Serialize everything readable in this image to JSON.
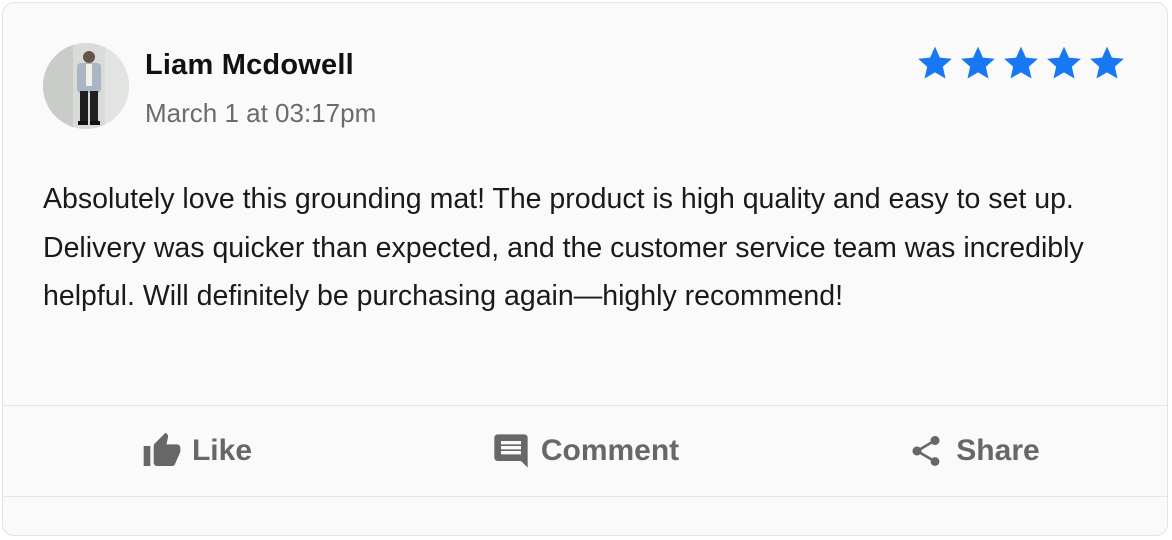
{
  "review": {
    "user_name": "Liam Mcdowell",
    "timestamp": "March 1 at 03:17pm",
    "rating": 5,
    "rating_max": 5,
    "star_color": "#1877f2",
    "text": "Absolutely love this grounding mat! The product is high quality and easy to set up. Delivery was quicker than expected, and the customer service team was incredibly helpful. Will definitely be purchasing again—highly recommend!"
  },
  "actions": {
    "like_label": "Like",
    "comment_label": "Comment",
    "share_label": "Share",
    "like_icon": "thumbs-up-icon",
    "comment_icon": "comment-icon",
    "share_icon": "share-icon"
  }
}
